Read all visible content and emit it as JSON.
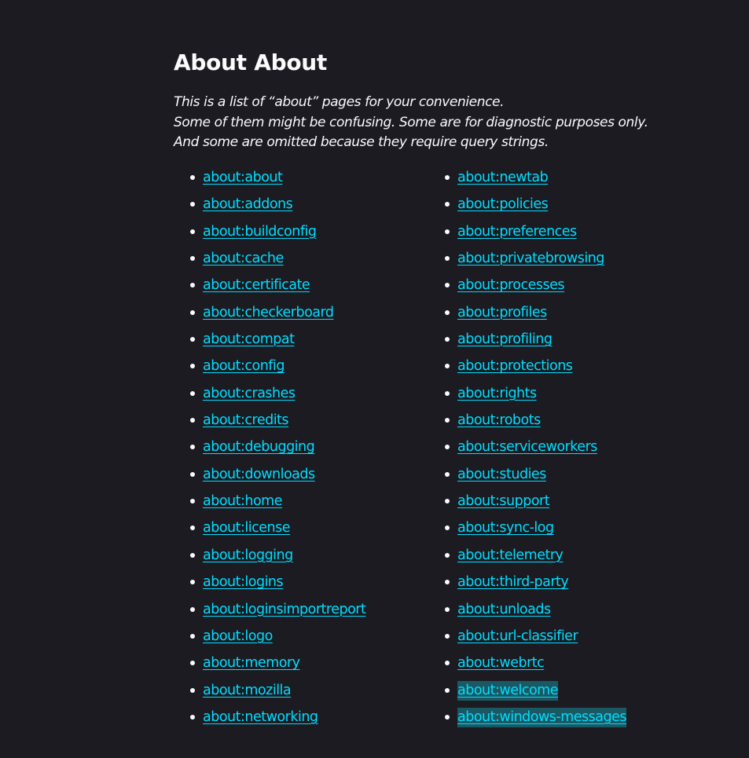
{
  "page": {
    "title": "About About",
    "intro_lines": [
      "This is a list of “about” pages for your convenience.",
      "Some of them might be confusing. Some are for diagnostic purposes only.",
      "And some are omitted because they require query strings."
    ]
  },
  "colors": {
    "background": "#1c1b22",
    "text": "#fbfbfe",
    "link": "#00ddff",
    "highlight": "#1a5863"
  },
  "lists": {
    "left": [
      {
        "label": "about:about"
      },
      {
        "label": "about:addons"
      },
      {
        "label": "about:buildconfig"
      },
      {
        "label": "about:cache"
      },
      {
        "label": "about:certificate"
      },
      {
        "label": "about:checkerboard"
      },
      {
        "label": "about:compat"
      },
      {
        "label": "about:config"
      },
      {
        "label": "about:crashes"
      },
      {
        "label": "about:credits"
      },
      {
        "label": "about:debugging"
      },
      {
        "label": "about:downloads"
      },
      {
        "label": "about:home"
      },
      {
        "label": "about:license"
      },
      {
        "label": "about:logging"
      },
      {
        "label": "about:logins"
      },
      {
        "label": "about:loginsimportreport"
      },
      {
        "label": "about:logo"
      },
      {
        "label": "about:memory"
      },
      {
        "label": "about:mozilla"
      },
      {
        "label": "about:networking"
      }
    ],
    "right": [
      {
        "label": "about:newtab"
      },
      {
        "label": "about:policies"
      },
      {
        "label": "about:preferences"
      },
      {
        "label": "about:privatebrowsing"
      },
      {
        "label": "about:processes"
      },
      {
        "label": "about:profiles"
      },
      {
        "label": "about:profiling"
      },
      {
        "label": "about:protections"
      },
      {
        "label": "about:rights"
      },
      {
        "label": "about:robots"
      },
      {
        "label": "about:serviceworkers"
      },
      {
        "label": "about:studies"
      },
      {
        "label": "about:support"
      },
      {
        "label": "about:sync-log"
      },
      {
        "label": "about:telemetry"
      },
      {
        "label": "about:third-party"
      },
      {
        "label": "about:unloads"
      },
      {
        "label": "about:url-classifier"
      },
      {
        "label": "about:webrtc"
      },
      {
        "label": "about:welcome",
        "highlighted": true
      },
      {
        "label": "about:windows-messages",
        "highlighted": true
      }
    ]
  }
}
